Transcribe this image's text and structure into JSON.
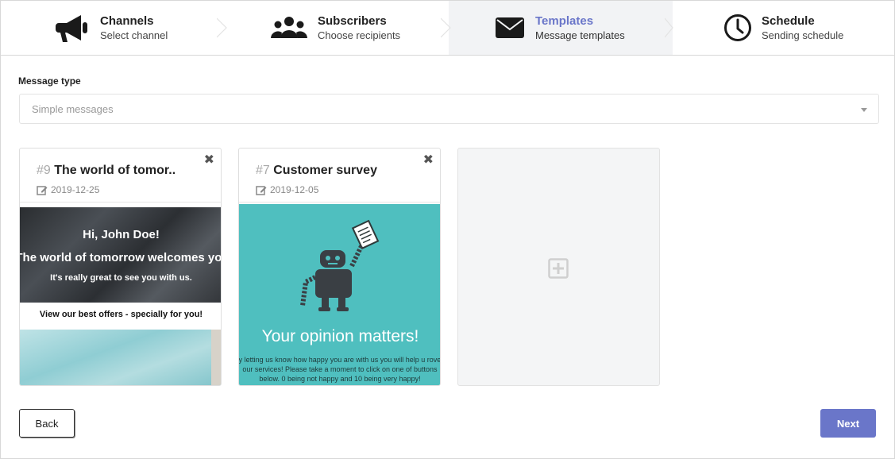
{
  "steps": [
    {
      "title": "Channels",
      "subtitle": "Select channel",
      "icon": "megaphone-icon"
    },
    {
      "title": "Subscribers",
      "subtitle": "Choose recipients",
      "icon": "users-icon"
    },
    {
      "title": "Templates",
      "subtitle": "Message templates",
      "icon": "envelope-icon",
      "active": true
    },
    {
      "title": "Schedule",
      "subtitle": "Sending schedule",
      "icon": "clock-icon"
    }
  ],
  "form": {
    "message_type_label": "Message type",
    "message_type_value": "Simple messages"
  },
  "templates": [
    {
      "num": "#9",
      "title": "The world of tomor..",
      "date": "2019-12-25",
      "preview": {
        "greeting": "Hi, John Doe!",
        "headline": "The world of tomorrow welcomes you",
        "subline": "It's really great to see you with us.",
        "offer": "View our best offers - specially for you!"
      }
    },
    {
      "num": "#7",
      "title": "Customer survey",
      "date": "2019-12-05",
      "preview": {
        "headline": "Your opinion matters!",
        "body": "y letting us know how happy you are with us you will help u rove our services! Please take a moment to click on one of buttons below. 0 being not happy and 10 being very happy!"
      }
    }
  ],
  "close_symbol": "✖",
  "buttons": {
    "back": "Back",
    "next": "Next"
  },
  "colors": {
    "accent": "#6a76c9",
    "survey_bg": "#4fbfbf"
  }
}
